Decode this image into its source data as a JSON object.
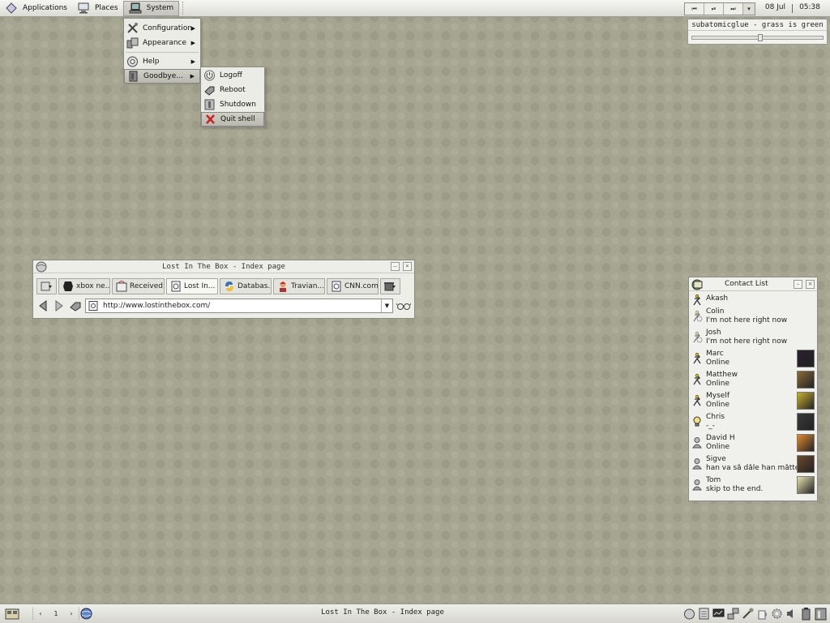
{
  "top_panel": {
    "menus": [
      {
        "label": "Applications",
        "icon": "diamond-icon"
      },
      {
        "label": "Places",
        "icon": "computer-icon"
      },
      {
        "label": "System",
        "icon": "laptop-icon"
      }
    ],
    "media": {
      "prev": "⏮",
      "play_pause": "⏯",
      "next": "⏭",
      "menu": "▾"
    },
    "date": "08 Jul",
    "time": "05:38"
  },
  "now_playing": {
    "title": "subatomicglue - grass is green",
    "position_fraction": 0.52
  },
  "system_menu": {
    "items": [
      {
        "label": "Configuration",
        "icon": "tools-icon",
        "submenu": true
      },
      {
        "label": "Appearance",
        "icon": "appearance-icon",
        "submenu": true
      },
      {
        "label": "Help",
        "icon": "lifebuoy-icon",
        "submenu": true
      },
      {
        "label": "Goodbye...",
        "icon": "door-icon",
        "submenu": true
      }
    ]
  },
  "goodbye_menu": {
    "items": [
      {
        "label": "Logoff",
        "icon": "power-icon"
      },
      {
        "label": "Reboot",
        "icon": "reboot-icon"
      },
      {
        "label": "Shutdown",
        "icon": "shutdown-icon"
      },
      {
        "label": "Quit shell",
        "icon": "red-x-icon"
      }
    ]
  },
  "browser": {
    "title": "Lost In The Box - Index page",
    "tabs": [
      {
        "label": "",
        "icon": "tab-menu-icon"
      },
      {
        "label": "xbox ne...",
        "icon": "xbox-icon"
      },
      {
        "label": "Received",
        "icon": "received-icon"
      },
      {
        "label": "Lost In...",
        "icon": "page-icon"
      },
      {
        "label": "Databas...",
        "icon": "python-icon"
      },
      {
        "label": "Travian...",
        "icon": "travian-icon"
      },
      {
        "label": "CNN.com...",
        "icon": "page-icon"
      },
      {
        "label": "",
        "icon": "trash-icon"
      }
    ],
    "url": "http://www.lostinthebox.com/"
  },
  "contacts": {
    "title": "Contact List",
    "items": [
      {
        "name": "Akash",
        "status": "",
        "state": "online"
      },
      {
        "name": "Colin",
        "status": "I'm not here right now",
        "state": "away"
      },
      {
        "name": "Josh",
        "status": "I'm not here right now",
        "state": "away"
      },
      {
        "name": "Marc",
        "status": "Online",
        "state": "online",
        "avatar": "#2a1f2e"
      },
      {
        "name": "Matthew",
        "status": "Online",
        "state": "online",
        "avatar": "#8a6a3a"
      },
      {
        "name": "Myself",
        "status": "Online",
        "state": "online",
        "avatar": "#c8b030"
      },
      {
        "name": "Chris",
        "status": "-_-",
        "state": "idea",
        "avatar": "#3a3a3a"
      },
      {
        "name": "David H",
        "status": "Online",
        "state": "offline",
        "avatar": "#e08a30"
      },
      {
        "name": "Sigve",
        "status": "han va så dåle han måtte få spaltisk hjelm",
        "state": "offline",
        "avatar": "#6a4a2a"
      },
      {
        "name": "Tom",
        "status": "skip to the end.",
        "state": "offline",
        "avatar": "#e8e2b0"
      }
    ]
  },
  "bottom_panel": {
    "title": "Lost In The Box - Index page",
    "page": "1",
    "prev": "‹",
    "next": "›"
  },
  "colors": {
    "desktop": "#a6a58f",
    "panel": "#e6e6e0",
    "highlight": "#c4c4bb",
    "quit_red": "#cc2222"
  }
}
